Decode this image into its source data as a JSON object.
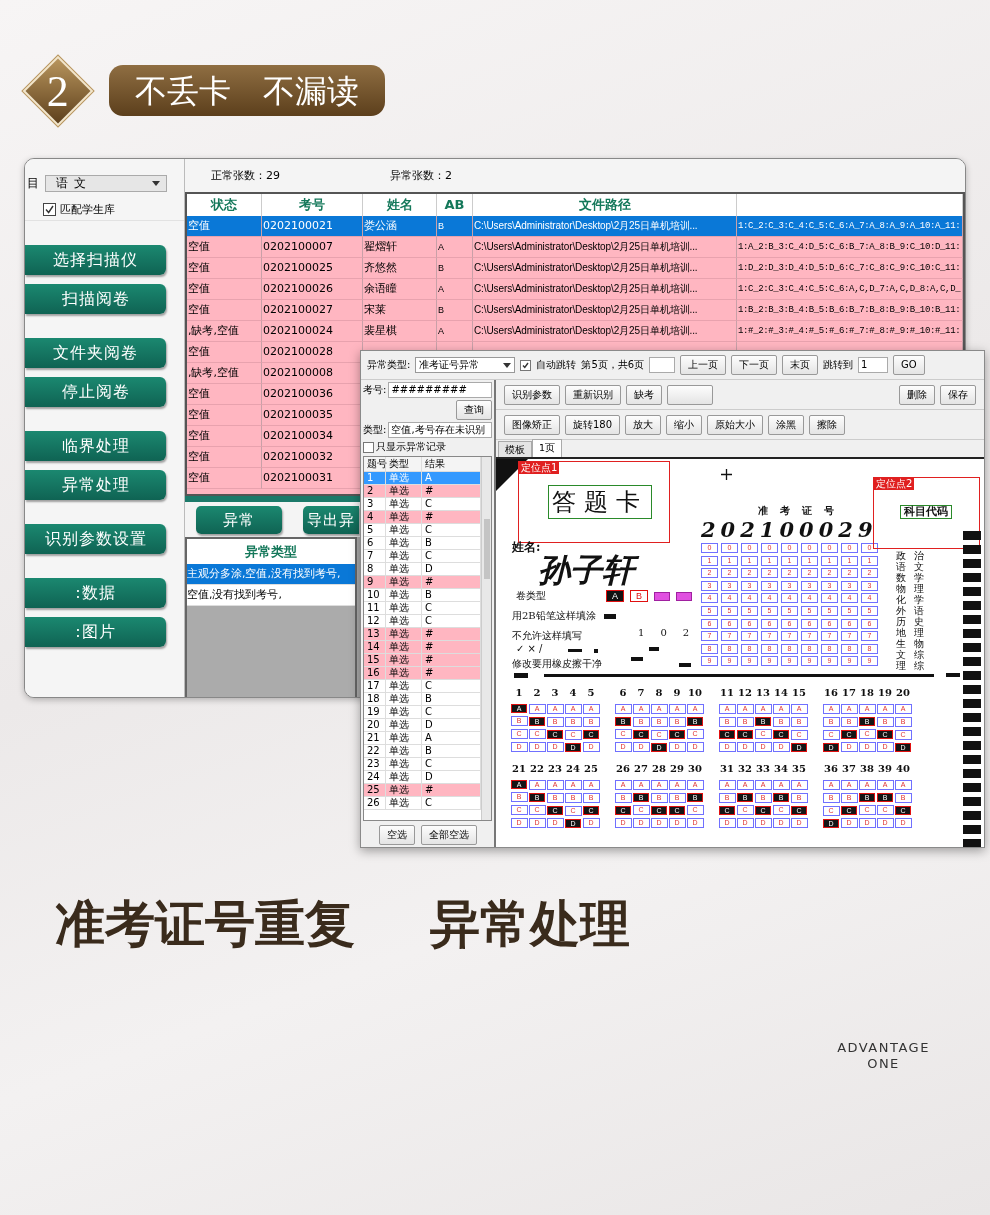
{
  "header": {
    "step": "2",
    "title": [
      "不丢卡",
      "不漏读"
    ]
  },
  "main_window": {
    "sidebar": {
      "label": "目",
      "subject": "语文",
      "match_checkbox": {
        "label": "匹配学生库",
        "checked": true
      },
      "button_groups": [
        [
          "选择扫描仪",
          "扫描阅卷"
        ],
        [
          "文件夹阅卷",
          "停止阅卷"
        ],
        [
          "临界处理",
          "异常处理"
        ],
        [
          "识别参数设置"
        ],
        [
          ":数据",
          ":图片"
        ]
      ]
    },
    "summary": [
      "正常张数：29",
      "异常张数：2"
    ],
    "table": {
      "columns": [
        "状态",
        "考号",
        "姓名",
        "AB",
        "文件路径"
      ],
      "rows": [
        {
          "status": "空值",
          "exam_no": "0202100021",
          "name": "娄公涵",
          "ab": "B",
          "path": "C:\\Users\\Administrator\\Desktop\\2月25日单机培训...",
          "answers": "1:C_2:C_3:C_4:C_5:C_6:A_7:A_8:A_9:A_10:A_11:",
          "selected": true
        },
        {
          "status": "空值",
          "exam_no": "0202100007",
          "name": "翟熠轩",
          "ab": "A",
          "path": "C:\\Users\\Administrator\\Desktop\\2月25日单机培训...",
          "answers": "1:A_2:B_3:C_4:D_5:C_6:B_7:A_8:B_9:C_10:D_11:",
          "selected": false
        },
        {
          "status": "空值",
          "exam_no": "0202100025",
          "name": "齐悠然",
          "ab": "B",
          "path": "C:\\Users\\Administrator\\Desktop\\2月25日单机培训...",
          "answers": "1:D_2:D_3:D_4:D_5:D_6:C_7:C_8:C_9:C_10:C_11:",
          "selected": false
        },
        {
          "status": "空值",
          "exam_no": "0202100026",
          "name": "余语瞳",
          "ab": "A",
          "path": "C:\\Users\\Administrator\\Desktop\\2月25日单机培训...",
          "answers": "1:C_2:C_3:C_4:C_5:C_6:A,C,D_7:A,C,D_8:A,C,D_",
          "selected": false
        },
        {
          "status": "空值",
          "exam_no": "0202100027",
          "name": "宋莱",
          "ab": "B",
          "path": "C:\\Users\\Administrator\\Desktop\\2月25日单机培训...",
          "answers": "1:B_2:B_3:B_4:B_5:B_6:B_7:B_8:B_9:B_10:B_11:",
          "selected": false
        },
        {
          "status": ",缺考,空值",
          "exam_no": "0202100024",
          "name": "裴星棋",
          "ab": "A",
          "path": "C:\\Users\\Administrator\\Desktop\\2月25日单机培训...",
          "answers": "1:#_2:#_3:#_4:#_5:#_6:#_7:#_8:#_9:#_10:#_11:",
          "selected": false
        },
        {
          "status": "空值",
          "exam_no": "0202100028",
          "selected": false
        },
        {
          "status": ",缺考,空值",
          "exam_no": "0202100008",
          "selected": false
        },
        {
          "status": "空值",
          "exam_no": "0202100036",
          "selected": false
        },
        {
          "status": "空值",
          "exam_no": "0202100035",
          "selected": false
        },
        {
          "status": "空值",
          "exam_no": "0202100034",
          "selected": false
        },
        {
          "status": "空值",
          "exam_no": "0202100032",
          "selected": false
        },
        {
          "status": "空值",
          "exam_no": "0202100031",
          "selected": false
        }
      ]
    },
    "buttons": [
      "异常",
      "导出异"
    ],
    "error_table": {
      "column": "异常类型",
      "rows": [
        {
          "text": "主观分多涂,空值,没有找到考号,",
          "selected": true
        },
        {
          "text": "空值,没有找到考号,",
          "selected": false
        }
      ]
    }
  },
  "review_window": {
    "type_label": "异常类型:",
    "type_select": "准考证号异常",
    "auto_jump": {
      "label": "自动跳转",
      "checked": true
    },
    "page_info": "第5页，共6页",
    "nav_buttons": [
      "上一页",
      "下一页",
      "末页"
    ],
    "jump_label": "跳转到",
    "jump_value": "1",
    "go": "GO",
    "exam_no_label": "考号:",
    "exam_no_value": "#########",
    "query": "查询",
    "kind_label": "类型:",
    "kind_value": "空值,考号存在未识别",
    "only_abnormal": {
      "label": "只显示异常记录",
      "checked": false
    },
    "list": {
      "columns": [
        "题号",
        "类型",
        "结果"
      ],
      "rows": [
        {
          "no": "1",
          "type": "单选",
          "result": "A",
          "selected": true
        },
        {
          "no": "2",
          "type": "单选",
          "result": "#",
          "flagged": true,
          "selected": false
        },
        {
          "no": "3",
          "type": "单选",
          "result": "C",
          "flagged": false,
          "selected": false
        },
        {
          "no": "4",
          "type": "单选",
          "result": "#",
          "flagged": true,
          "selected": false
        },
        {
          "no": "5",
          "type": "单选",
          "result": "C",
          "flagged": false,
          "selected": false
        },
        {
          "no": "6",
          "type": "单选",
          "result": "B",
          "flagged": false,
          "selected": false
        },
        {
          "no": "7",
          "type": "单选",
          "result": "C",
          "flagged": false,
          "selected": false
        },
        {
          "no": "8",
          "type": "单选",
          "result": "D",
          "flagged": false,
          "selected": false
        },
        {
          "no": "9",
          "type": "单选",
          "result": "#",
          "flagged": true,
          "selected": false
        },
        {
          "no": "10",
          "type": "单选",
          "result": "B",
          "flagged": false,
          "selected": false
        },
        {
          "no": "11",
          "type": "单选",
          "result": "C",
          "flagged": false,
          "selected": false
        },
        {
          "no": "12",
          "type": "单选",
          "result": "C",
          "flagged": false,
          "selected": false
        },
        {
          "no": "13",
          "type": "单选",
          "result": "#",
          "flagged": true,
          "selected": false
        },
        {
          "no": "14",
          "type": "单选",
          "result": "#",
          "flagged": true,
          "selected": false
        },
        {
          "no": "15",
          "type": "单选",
          "result": "#",
          "flagged": true,
          "selected": false
        },
        {
          "no": "16",
          "type": "单选",
          "result": "#",
          "flagged": true,
          "selected": false
        },
        {
          "no": "17",
          "type": "单选",
          "result": "C",
          "flagged": false,
          "selected": false
        },
        {
          "no": "18",
          "type": "单选",
          "result": "B",
          "flagged": false,
          "selected": false
        },
        {
          "no": "19",
          "type": "单选",
          "result": "C",
          "flagged": false,
          "selected": false
        },
        {
          "no": "20",
          "type": "单选",
          "result": "D",
          "flagged": false,
          "selected": false
        },
        {
          "no": "21",
          "type": "单选",
          "result": "A",
          "flagged": false,
          "selected": false
        },
        {
          "no": "22",
          "type": "单选",
          "result": "B",
          "flagged": false,
          "selected": false
        },
        {
          "no": "23",
          "type": "单选",
          "result": "C",
          "flagged": false,
          "selected": false
        },
        {
          "no": "24",
          "type": "单选",
          "result": "D",
          "flagged": false,
          "selected": false
        },
        {
          "no": "25",
          "type": "单选",
          "result": "#",
          "flagged": true,
          "selected": false
        },
        {
          "no": "26",
          "type": "单选",
          "result": "C",
          "flagged": false,
          "selected": false
        }
      ]
    },
    "list_buttons": [
      "空选",
      "全部空选"
    ],
    "toolbar": {
      "row1_left": [
        "识别参数",
        "重新识别",
        "缺考"
      ],
      "row1_right": [
        "删除",
        "保存"
      ],
      "row2": [
        "图像矫正",
        "旋转180",
        "放大",
        "缩小",
        "原始大小",
        "涂黑",
        "擦除"
      ]
    },
    "tabs": [
      {
        "label": "模板",
        "selected": false
      },
      {
        "label": "1页",
        "selected": true
      }
    ],
    "sheet": {
      "anchor1": "定位点1",
      "anchor2": "定位点2",
      "title": "答题卡",
      "exam_no_title": "准考证号",
      "handwritten_no": "202100029",
      "name_label": "姓名:",
      "handwritten_name": "孙子轩",
      "paper_type_label": "卷类型",
      "paper_types": [
        {
          "label": "A",
          "filled": true
        },
        {
          "label": "B",
          "filled": false
        }
      ],
      "fill_hint": "用2B铅笔这样填涂",
      "wrong_hint": "不允许这样填写",
      "wrong_marks": "✓  ×  /",
      "erase_hint": "修改要用橡皮擦干净",
      "code_digits": [
        "1",
        "0",
        "2"
      ],
      "subject_code_title": "科目代码",
      "subjects": [
        "政治",
        "语文",
        "数学",
        "物理",
        "化学",
        "外语",
        "历史",
        "地理",
        "生物",
        "文综",
        "理综"
      ],
      "id_grid": [
        [
          "0",
          "1",
          "2",
          "3",
          "4",
          "5",
          "6",
          "7",
          "8",
          "9"
        ],
        [
          "0",
          "1",
          "2",
          "3",
          "4",
          "5",
          "6",
          "7",
          "8",
          "9"
        ],
        [
          "0",
          "1",
          "2",
          "3",
          "4",
          "5",
          "6",
          "7",
          "8",
          "9"
        ],
        [
          "0",
          "1",
          "2",
          "3",
          "4",
          "5",
          "6",
          "7",
          "8",
          "9"
        ],
        [
          "0",
          "1",
          "2",
          "3",
          "4",
          "5",
          "6",
          "7",
          "8",
          "9"
        ],
        [
          "0",
          "1",
          "2",
          "3",
          "4",
          "5",
          "6",
          "7",
          "8",
          "9"
        ],
        [
          "0",
          "1",
          "2",
          "3",
          "4",
          "5",
          "6",
          "7",
          "8",
          "9"
        ],
        [
          "0",
          "1",
          "2",
          "3",
          "4",
          "5",
          "6",
          "7",
          "8",
          "9"
        ],
        [
          "0",
          "1",
          "2",
          "3",
          "4",
          "5",
          "6",
          "7",
          "8",
          "9"
        ]
      ],
      "questions": [
        {
          "number": "1",
          "options": [
            {
              "label": "A",
              "filled": true
            },
            {
              "label": "B",
              "filled": false
            },
            {
              "label": "C",
              "filled": false
            },
            {
              "label": "D",
              "filled": false
            }
          ]
        },
        {
          "number": "2",
          "options": [
            {
              "label": "A",
              "filled": false
            },
            {
              "label": "B",
              "filled": true
            },
            {
              "label": "C",
              "filled": false
            },
            {
              "label": "D",
              "filled": false
            }
          ]
        },
        {
          "number": "3",
          "options": [
            {
              "label": "A",
              "filled": false
            },
            {
              "label": "B",
              "filled": false
            },
            {
              "label": "C",
              "filled": true
            },
            {
              "label": "D",
              "filled": false
            }
          ]
        },
        {
          "number": "4",
          "options": [
            {
              "label": "A",
              "filled": false
            },
            {
              "label": "B",
              "filled": false
            },
            {
              "label": "C",
              "filled": false
            },
            {
              "label": "D",
              "filled": true
            }
          ]
        },
        {
          "number": "5",
          "options": [
            {
              "label": "A",
              "filled": false
            },
            {
              "label": "B",
              "filled": false
            },
            {
              "label": "C",
              "filled": true
            },
            {
              "label": "D",
              "filled": false
            }
          ]
        },
        {
          "number": "6",
          "options": [
            {
              "label": "A",
              "filled": false
            },
            {
              "label": "B",
              "filled": true
            },
            {
              "label": "C",
              "filled": false
            },
            {
              "label": "D",
              "filled": false
            }
          ]
        },
        {
          "number": "7",
          "options": [
            {
              "label": "A",
              "filled": false
            },
            {
              "label": "B",
              "filled": false
            },
            {
              "label": "C",
              "filled": true
            },
            {
              "label": "D",
              "filled": false
            }
          ]
        },
        {
          "number": "8",
          "options": [
            {
              "label": "A",
              "filled": false
            },
            {
              "label": "B",
              "filled": false
            },
            {
              "label": "C",
              "filled": false
            },
            {
              "label": "D",
              "filled": true
            }
          ]
        },
        {
          "number": "9",
          "options": [
            {
              "label": "A",
              "filled": false
            },
            {
              "label": "B",
              "filled": false
            },
            {
              "label": "C",
              "filled": true
            },
            {
              "label": "D",
              "filled": false
            }
          ]
        },
        {
          "number": "10",
          "options": [
            {
              "label": "A",
              "filled": false
            },
            {
              "label": "B",
              "filled": true
            },
            {
              "label": "C",
              "filled": false
            },
            {
              "label": "D",
              "filled": false
            }
          ]
        },
        {
          "number": "11",
          "options": [
            {
              "label": "A",
              "filled": false
            },
            {
              "label": "B",
              "filled": false
            },
            {
              "label": "C",
              "filled": true
            },
            {
              "label": "D",
              "filled": false
            }
          ]
        },
        {
          "number": "12",
          "options": [
            {
              "label": "A",
              "filled": false
            },
            {
              "label": "B",
              "filled": false
            },
            {
              "label": "C",
              "filled": true
            },
            {
              "label": "D",
              "filled": false
            }
          ]
        },
        {
          "number": "13",
          "options": [
            {
              "label": "A",
              "filled": false
            },
            {
              "label": "B",
              "filled": true
            },
            {
              "label": "C",
              "filled": false
            },
            {
              "label": "D",
              "filled": false
            }
          ]
        },
        {
          "number": "14",
          "options": [
            {
              "label": "A",
              "filled": false
            },
            {
              "label": "B",
              "filled": false
            },
            {
              "label": "C",
              "filled": true
            },
            {
              "label": "D",
              "filled": false
            }
          ]
        },
        {
          "number": "15",
          "options": [
            {
              "label": "A",
              "filled": false
            },
            {
              "label": "B",
              "filled": false
            },
            {
              "label": "C",
              "filled": false
            },
            {
              "label": "D",
              "filled": true
            }
          ]
        },
        {
          "number": "16",
          "options": [
            {
              "label": "A",
              "filled": false
            },
            {
              "label": "B",
              "filled": false
            },
            {
              "label": "C",
              "filled": false
            },
            {
              "label": "D",
              "filled": true
            }
          ]
        },
        {
          "number": "17",
          "options": [
            {
              "label": "A",
              "filled": false
            },
            {
              "label": "B",
              "filled": false
            },
            {
              "label": "C",
              "filled": true
            },
            {
              "label": "D",
              "filled": false
            }
          ]
        },
        {
          "number": "18",
          "options": [
            {
              "label": "A",
              "filled": false
            },
            {
              "label": "B",
              "filled": true
            },
            {
              "label": "C",
              "filled": false
            },
            {
              "label": "D",
              "filled": false
            }
          ]
        },
        {
          "number": "19",
          "options": [
            {
              "label": "A",
              "filled": false
            },
            {
              "label": "B",
              "filled": false
            },
            {
              "label": "C",
              "filled": true
            },
            {
              "label": "D",
              "filled": false
            }
          ]
        },
        {
          "number": "20",
          "options": [
            {
              "label": "A",
              "filled": false
            },
            {
              "label": "B",
              "filled": false
            },
            {
              "label": "C",
              "filled": false
            },
            {
              "label": "D",
              "filled": true
            }
          ]
        },
        {
          "number": "21",
          "options": [
            {
              "label": "A",
              "filled": true
            },
            {
              "label": "B",
              "filled": false
            },
            {
              "label": "C",
              "filled": false
            },
            {
              "label": "D",
              "filled": false
            }
          ]
        },
        {
          "number": "22",
          "options": [
            {
              "label": "A",
              "filled": false
            },
            {
              "label": "B",
              "filled": true
            },
            {
              "label": "C",
              "filled": false
            },
            {
              "label": "D",
              "filled": false
            }
          ]
        },
        {
          "number": "23",
          "options": [
            {
              "label": "A",
              "filled": false
            },
            {
              "label": "B",
              "filled": false
            },
            {
              "label": "C",
              "filled": true
            },
            {
              "label": "D",
              "filled": false
            }
          ]
        },
        {
          "number": "24",
          "options": [
            {
              "label": "A",
              "filled": false
            },
            {
              "label": "B",
              "filled": false
            },
            {
              "label": "C",
              "filled": false
            },
            {
              "label": "D",
              "filled": true
            }
          ]
        },
        {
          "number": "25",
          "options": [
            {
              "label": "A",
              "filled": false
            },
            {
              "label": "B",
              "filled": false
            },
            {
              "label": "C",
              "filled": true
            },
            {
              "label": "D",
              "filled": false
            }
          ]
        },
        {
          "number": "26",
          "options": [
            {
              "label": "A",
              "filled": false
            },
            {
              "label": "B",
              "filled": false
            },
            {
              "label": "C",
              "filled": true
            },
            {
              "label": "D",
              "filled": false
            }
          ]
        },
        {
          "number": "27",
          "options": [
            {
              "label": "A",
              "filled": false
            },
            {
              "label": "B",
              "filled": true
            },
            {
              "label": "C",
              "filled": false
            },
            {
              "label": "D",
              "filled": false
            }
          ]
        },
        {
          "number": "28",
          "options": [
            {
              "label": "A",
              "filled": false
            },
            {
              "label": "B",
              "filled": false
            },
            {
              "label": "C",
              "filled": true
            },
            {
              "label": "D",
              "filled": false
            }
          ]
        },
        {
          "number": "29",
          "options": [
            {
              "label": "A",
              "filled": false
            },
            {
              "label": "B",
              "filled": false
            },
            {
              "label": "C",
              "filled": true
            },
            {
              "label": "D",
              "filled": false
            }
          ]
        },
        {
          "number": "30",
          "options": [
            {
              "label": "A",
              "filled": false
            },
            {
              "label": "B",
              "filled": true
            },
            {
              "label": "C",
              "filled": false
            },
            {
              "label": "D",
              "filled": false
            }
          ]
        },
        {
          "number": "31",
          "options": [
            {
              "label": "A",
              "filled": false
            },
            {
              "label": "B",
              "filled": false
            },
            {
              "label": "C",
              "filled": true
            },
            {
              "label": "D",
              "filled": false
            }
          ]
        },
        {
          "number": "32",
          "options": [
            {
              "label": "A",
              "filled": false
            },
            {
              "label": "B",
              "filled": true
            },
            {
              "label": "C",
              "filled": false
            },
            {
              "label": "D",
              "filled": false
            }
          ]
        },
        {
          "number": "33",
          "options": [
            {
              "label": "A",
              "filled": false
            },
            {
              "label": "B",
              "filled": false
            },
            {
              "label": "C",
              "filled": true
            },
            {
              "label": "D",
              "filled": false
            }
          ]
        },
        {
          "number": "34",
          "options": [
            {
              "label": "A",
              "filled": false
            },
            {
              "label": "B",
              "filled": true
            },
            {
              "label": "C",
              "filled": false
            },
            {
              "label": "D",
              "filled": false
            }
          ]
        },
        {
          "number": "35",
          "options": [
            {
              "label": "A",
              "filled": false
            },
            {
              "label": "B",
              "filled": false
            },
            {
              "label": "C",
              "filled": true
            },
            {
              "label": "D",
              "filled": false
            }
          ]
        },
        {
          "number": "36",
          "options": [
            {
              "label": "A",
              "filled": false
            },
            {
              "label": "B",
              "filled": false
            },
            {
              "label": "C",
              "filled": false
            },
            {
              "label": "D",
              "filled": true
            }
          ]
        },
        {
          "number": "37",
          "options": [
            {
              "label": "A",
              "filled": false
            },
            {
              "label": "B",
              "filled": false
            },
            {
              "label": "C",
              "filled": true
            },
            {
              "label": "D",
              "filled": false
            }
          ]
        },
        {
          "number": "38",
          "options": [
            {
              "label": "A",
              "filled": false
            },
            {
              "label": "B",
              "filled": true
            },
            {
              "label": "C",
              "filled": false
            },
            {
              "label": "D",
              "filled": false
            }
          ]
        },
        {
          "number": "39",
          "options": [
            {
              "label": "A",
              "filled": false
            },
            {
              "label": "B",
              "filled": true
            },
            {
              "label": "C",
              "filled": false
            },
            {
              "label": "D",
              "filled": false
            }
          ]
        },
        {
          "number": "40",
          "options": [
            {
              "label": "A",
              "filled": false
            },
            {
              "label": "B",
              "filled": false
            },
            {
              "label": "C",
              "filled": true
            },
            {
              "label": "D",
              "filled": false
            }
          ]
        }
      ]
    }
  },
  "caption": [
    "准考证号重复",
    "异常处理"
  ],
  "brand": [
    "ADVANTAGE",
    "ONE"
  ]
}
